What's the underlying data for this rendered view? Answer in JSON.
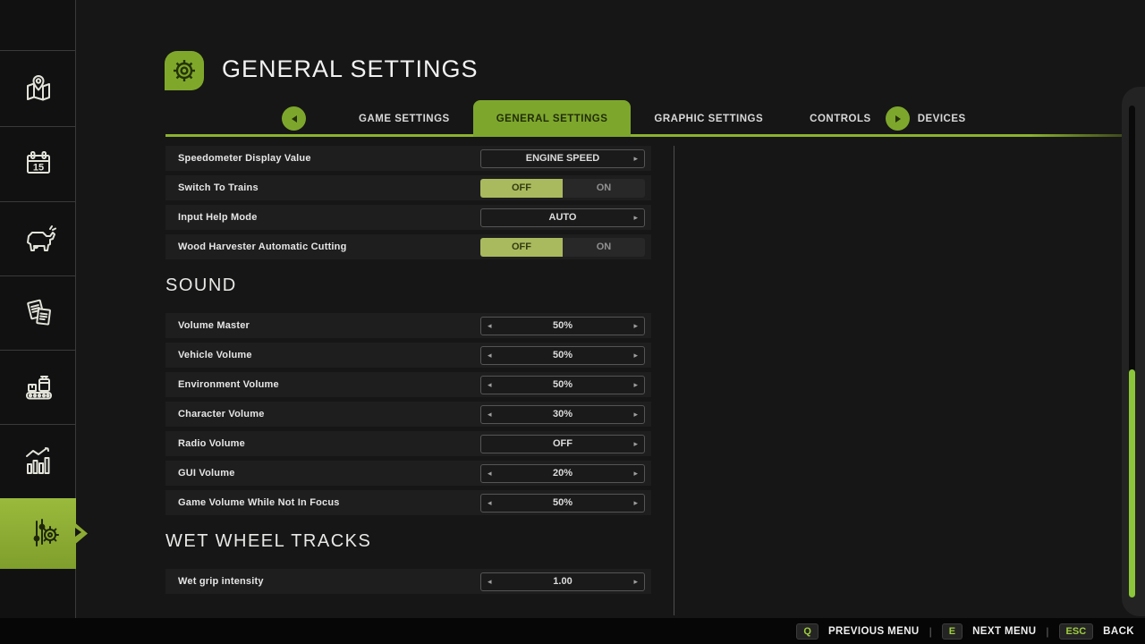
{
  "header": {
    "title": "GENERAL SETTINGS",
    "icon": "gear-icon"
  },
  "tabs": {
    "prev_button": "left-arrow",
    "next_button": "right-arrow",
    "items": [
      {
        "label": "GAME SETTINGS",
        "active": false
      },
      {
        "label": "GENERAL SETTINGS",
        "active": true
      },
      {
        "label": "GRAPHIC SETTINGS",
        "active": false
      },
      {
        "label": "CONTROLS",
        "active": false
      },
      {
        "label": "DEVICES",
        "active": false
      }
    ]
  },
  "sections": [
    {
      "heading": null,
      "rows": [
        {
          "label": "Speedometer Display Value",
          "control": {
            "type": "selector",
            "value": "ENGINE SPEED",
            "left_arrow": false,
            "right_arrow": true
          }
        },
        {
          "label": "Switch To Trains",
          "control": {
            "type": "toggle",
            "options": [
              "OFF",
              "ON"
            ],
            "selected": 0
          }
        },
        {
          "label": "Input Help Mode",
          "control": {
            "type": "selector",
            "value": "AUTO",
            "left_arrow": false,
            "right_arrow": true
          }
        },
        {
          "label": "Wood Harvester Automatic Cutting",
          "control": {
            "type": "toggle",
            "options": [
              "OFF",
              "ON"
            ],
            "selected": 0
          }
        }
      ]
    },
    {
      "heading": "SOUND",
      "rows": [
        {
          "label": "Volume Master",
          "control": {
            "type": "selector",
            "value": "50%",
            "left_arrow": true,
            "right_arrow": true
          }
        },
        {
          "label": "Vehicle Volume",
          "control": {
            "type": "selector",
            "value": "50%",
            "left_arrow": true,
            "right_arrow": true
          }
        },
        {
          "label": "Environment Volume",
          "control": {
            "type": "selector",
            "value": "50%",
            "left_arrow": true,
            "right_arrow": true
          }
        },
        {
          "label": "Character Volume",
          "control": {
            "type": "selector",
            "value": "30%",
            "left_arrow": true,
            "right_arrow": true
          }
        },
        {
          "label": "Radio Volume",
          "control": {
            "type": "selector",
            "value": "OFF",
            "left_arrow": false,
            "right_arrow": true
          }
        },
        {
          "label": "GUI Volume",
          "control": {
            "type": "selector",
            "value": "20%",
            "left_arrow": true,
            "right_arrow": true
          }
        },
        {
          "label": "Game Volume While Not In Focus",
          "control": {
            "type": "selector",
            "value": "50%",
            "left_arrow": true,
            "right_arrow": true
          }
        }
      ]
    },
    {
      "heading": "WET WHEEL TRACKS",
      "rows": [
        {
          "label": "Wet grip intensity",
          "control": {
            "type": "selector",
            "value": "1.00",
            "left_arrow": true,
            "right_arrow": true
          }
        }
      ]
    }
  ],
  "sidebar": {
    "items": [
      {
        "icon": null,
        "name": "sidebar-item-top",
        "active": false
      },
      {
        "icon": "map-icon",
        "name": "sidebar-item-map",
        "active": false
      },
      {
        "icon": "calendar-icon",
        "name": "sidebar-item-calendar",
        "active": false,
        "calendar_day": "15"
      },
      {
        "icon": "animals-icon",
        "name": "sidebar-item-animals",
        "active": false
      },
      {
        "icon": "contracts-icon",
        "name": "sidebar-item-contracts",
        "active": false
      },
      {
        "icon": "production-icon",
        "name": "sidebar-item-production",
        "active": false
      },
      {
        "icon": "statistics-icon",
        "name": "sidebar-item-statistics",
        "active": false
      },
      {
        "icon": "settings-icon",
        "name": "sidebar-item-settings",
        "active": true
      }
    ]
  },
  "footer": {
    "shortcuts": [
      {
        "key": "Q",
        "label": "PREVIOUS MENU"
      },
      {
        "key": "E",
        "label": "NEXT MENU"
      },
      {
        "key": "ESC",
        "label": "BACK"
      }
    ]
  },
  "colors": {
    "accent_green": "#7da72c",
    "bright_green": "#8cc63a",
    "toggle_green": "#a9ba5e",
    "underline_green": "#8cb32e",
    "row_bg": "#1e1e1e",
    "page_bg": "#161616",
    "footer_bg": "#060606"
  }
}
